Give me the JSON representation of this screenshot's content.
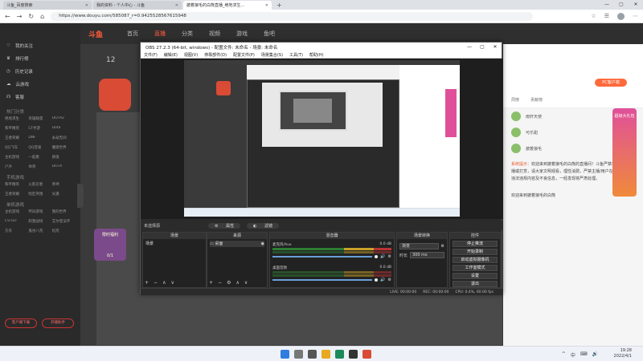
{
  "browser": {
    "tabs": [
      {
        "title": "斗鱼_百度搜索",
        "active": false
      },
      {
        "title": "我的资料 - 个人中心 - 斗鱼",
        "active": false
      },
      {
        "title": "披着狼毛的白熊直播_绝地求生...",
        "active": true
      }
    ],
    "new_tab": "+",
    "url": "https://www.douyu.com/585087_r=0.9425528567615948",
    "window_controls": [
      "—",
      "▢",
      "✕"
    ]
  },
  "site": {
    "logo": "斗鱼",
    "nav": [
      "首页",
      "直播",
      "分类",
      "视频",
      "游戏",
      "鱼吧"
    ],
    "nav_active": 1,
    "sidebar": {
      "items": [
        "我的关注",
        "排行榜",
        "历史记录",
        "云游戏",
        "客服"
      ],
      "section1": "热门分类",
      "grid1": [
        "绝地求生",
        "英雄联盟",
        "DOTA2",
        "和平精英",
        "CF手游",
        "Dota",
        "王者荣耀",
        "DNF",
        "永劫无间",
        "QQ飞车",
        "QQ音速",
        "魔兽世界",
        "主机游戏",
        "一起看",
        "颜值",
        "户外",
        "体育",
        "DOTA"
      ],
      "section2": "手机游戏",
      "grid2": [
        "和平精英",
        "火影忍者",
        "原神",
        "王者荣耀",
        "暗区突围",
        "光遇"
      ],
      "section3": "单机游戏",
      "grid3": [
        "主机游戏",
        "怀旧游戏",
        "我的世界",
        "CS:GO",
        "刺激战场",
        "艾尔登法环",
        "方舟",
        "鬼谷八荒",
        "饥荒"
      ],
      "bottom_buttons": [
        "客户端下载",
        "开播助手"
      ]
    },
    "streamer_stat": "12",
    "promo_text": "限时福利",
    "promo_count": "0/1",
    "right_panel": {
      "top_button": "PC客户端",
      "tabs": [
        "周榜",
        "贡献榜"
      ],
      "rank_users": [
        "雨轩天使",
        "可乐甜",
        "披着狼毛"
      ],
      "gift_banner": "超级大礼包",
      "chat_notice": "欢迎来到披着狼毛的白熊的直播间！斗鱼严禁未成年人直播或打赏，请大家文明观看，理性消费。严禁主播/用户在直播间发布违法违规内容及不良信息，一经发现将严肃处理。",
      "chat_hl": "系统提示：",
      "bottom_label": "欢迎来到披着狼毛的白熊"
    }
  },
  "obs": {
    "title": "OBS 27.2.3 (64-bit, windows) - 配置文件: 未命名 - 场景: 未命名",
    "menu": [
      "文件(F)",
      "编辑(E)",
      "视图(V)",
      "停靠部件(D)",
      "配置文件(P)",
      "场景集合(S)",
      "工具(T)",
      "帮助(H)"
    ],
    "source_bar": "未选择源",
    "source_bar_buttons": [
      "属性",
      "滤镜"
    ],
    "docks": {
      "scenes": {
        "title": "场景",
        "items": [
          "场景"
        ]
      },
      "sources": {
        "title": "来源",
        "items": [
          "桌面"
        ]
      },
      "mixer": {
        "title": "混音器",
        "channels": [
          {
            "name": "麦克风/Aux",
            "db": "0.0 dB"
          },
          {
            "name": "桌面音频",
            "db": "0.0 dB"
          }
        ]
      },
      "transitions": {
        "title": "场景转换",
        "type": "渐变",
        "duration_label": "时长",
        "duration": "300 ms"
      },
      "controls": {
        "title": "控件",
        "buttons": [
          "停止推流",
          "开始录制",
          "启动虚拟摄像机",
          "工作室模式",
          "设置",
          "退出"
        ]
      }
    },
    "status": [
      "LIVE: 00:00:00",
      "REC: 00:00:00",
      "CPU: 0.4%, 60.00 fps"
    ]
  },
  "taskbar": {
    "time": "19:28",
    "date": "2022/4/1",
    "tray": [
      "^",
      "中",
      "⌨",
      "🔊"
    ]
  },
  "colors": {
    "brand": "#ff5a3c",
    "obs_bg": "#2b2b2b",
    "page_dark": "#3a3a3a"
  }
}
